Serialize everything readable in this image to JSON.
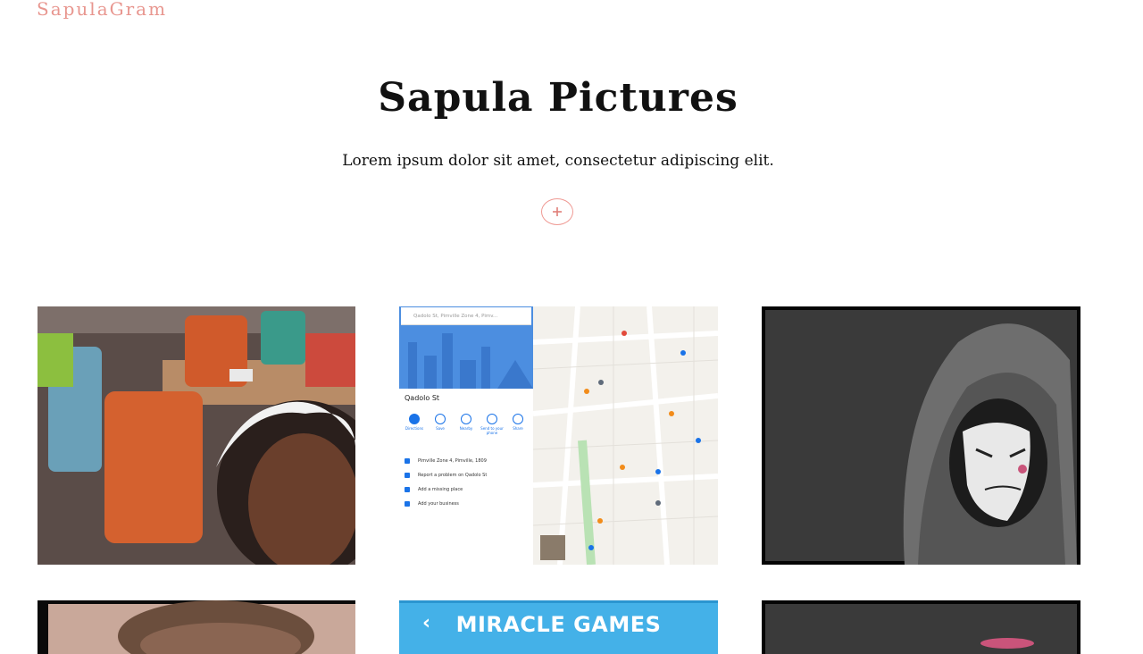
{
  "header": {
    "brand": "SapulaGram"
  },
  "hero": {
    "title": "Sapula Pictures",
    "subtitle": "Lorem ipsum dolor sit amet, consectetur adipiscing elit.",
    "add_button_glyph": "+"
  },
  "gallery": {
    "items": [
      {
        "subject": "girl-at-cafe-photo"
      },
      {
        "subject": "map-screenshot",
        "map": {
          "search_text": "Qadolo St, Pimville Zone 4, Pimv...",
          "place_name": "Qadolo St",
          "actions": [
            "Directions",
            "Save",
            "Nearby",
            "Send to your phone",
            "Share"
          ],
          "rows": [
            "Pimville Zone 4, Pimville, 1809",
            "Report a problem on Qadolo St",
            "Add a missing place",
            "Add your business"
          ]
        }
      },
      {
        "subject": "anonymous-mask-hoodie-photo"
      },
      {
        "subject": "boy-portrait-photo"
      },
      {
        "subject": "miracle-games-banner",
        "banner_title": "MIRACLE GAMES",
        "back_glyph": "‹"
      },
      {
        "subject": "dark-photo"
      }
    ]
  },
  "colors": {
    "brand": "#e8968f",
    "accent_ring": "#ef9a94",
    "banner": "#44b1e8"
  }
}
